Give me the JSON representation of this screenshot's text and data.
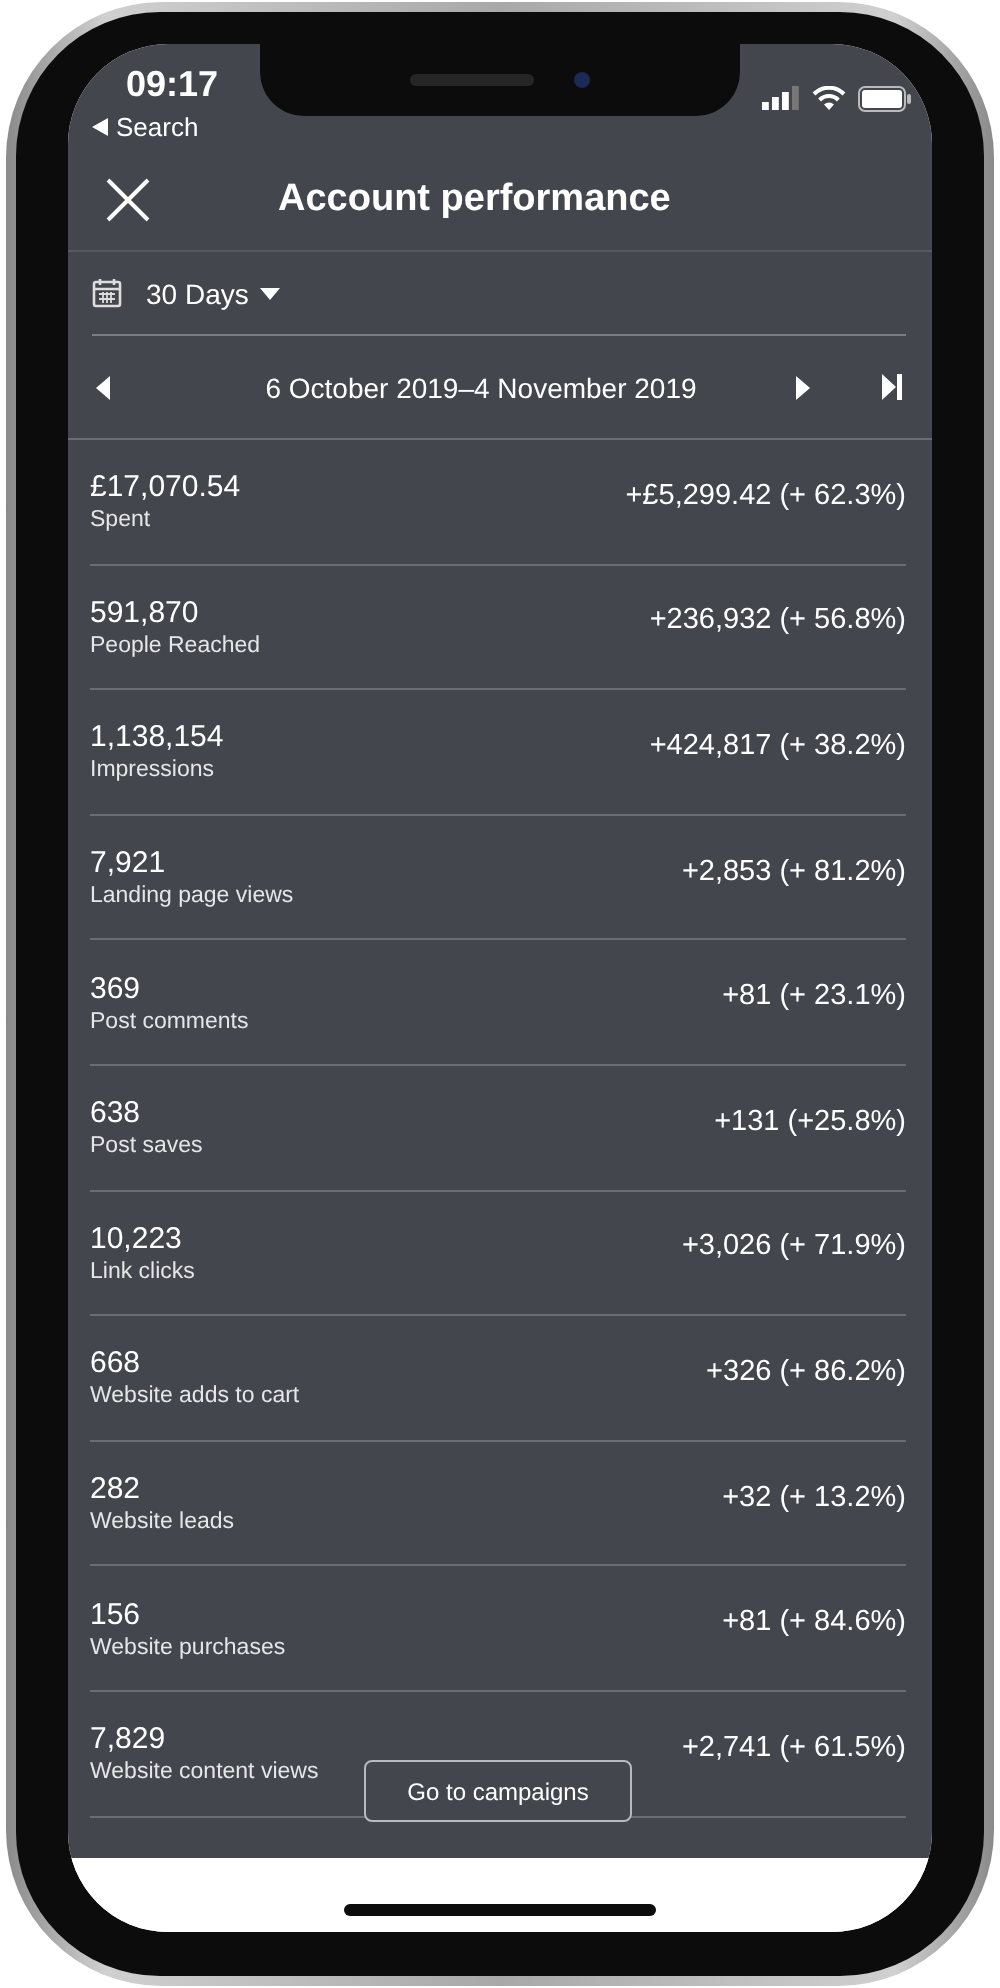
{
  "status_bar": {
    "time": "09:17",
    "back_label": "Search"
  },
  "header": {
    "title": "Account performance"
  },
  "filter": {
    "label": "30 Days"
  },
  "date_range": {
    "label": "6 October 2019–4 November 2019"
  },
  "metrics": [
    {
      "value": "£17,070.54",
      "label": "Spent",
      "change": "+£5,299.42 (+ 62.3%)"
    },
    {
      "value": "591,870",
      "label": "People Reached",
      "change": "+236,932 (+ 56.8%)"
    },
    {
      "value": "1,138,154",
      "label": "Impressions",
      "change": "+424,817 (+ 38.2%)"
    },
    {
      "value": "7,921",
      "label": "Landing page views",
      "change": "+2,853 (+ 81.2%)"
    },
    {
      "value": "369",
      "label": "Post comments",
      "change": "+81 (+ 23.1%)"
    },
    {
      "value": "638",
      "label": "Post saves",
      "change": "+131 (+25.8%)"
    },
    {
      "value": "10,223",
      "label": "Link clicks",
      "change": "+3,026 (+ 71.9%)"
    },
    {
      "value": "668",
      "label": "Website adds to cart",
      "change": "+326 (+ 86.2%)"
    },
    {
      "value": "282",
      "label": "Website leads",
      "change": "+32 (+ 13.2%)"
    },
    {
      "value": "156",
      "label": "Website purchases",
      "change": "+81 (+ 84.6%)"
    },
    {
      "value": "7,829",
      "label": "Website content views",
      "change": "+2,741 (+ 61.5%)"
    }
  ],
  "floating_button": {
    "label": "Go to campaigns"
  }
}
